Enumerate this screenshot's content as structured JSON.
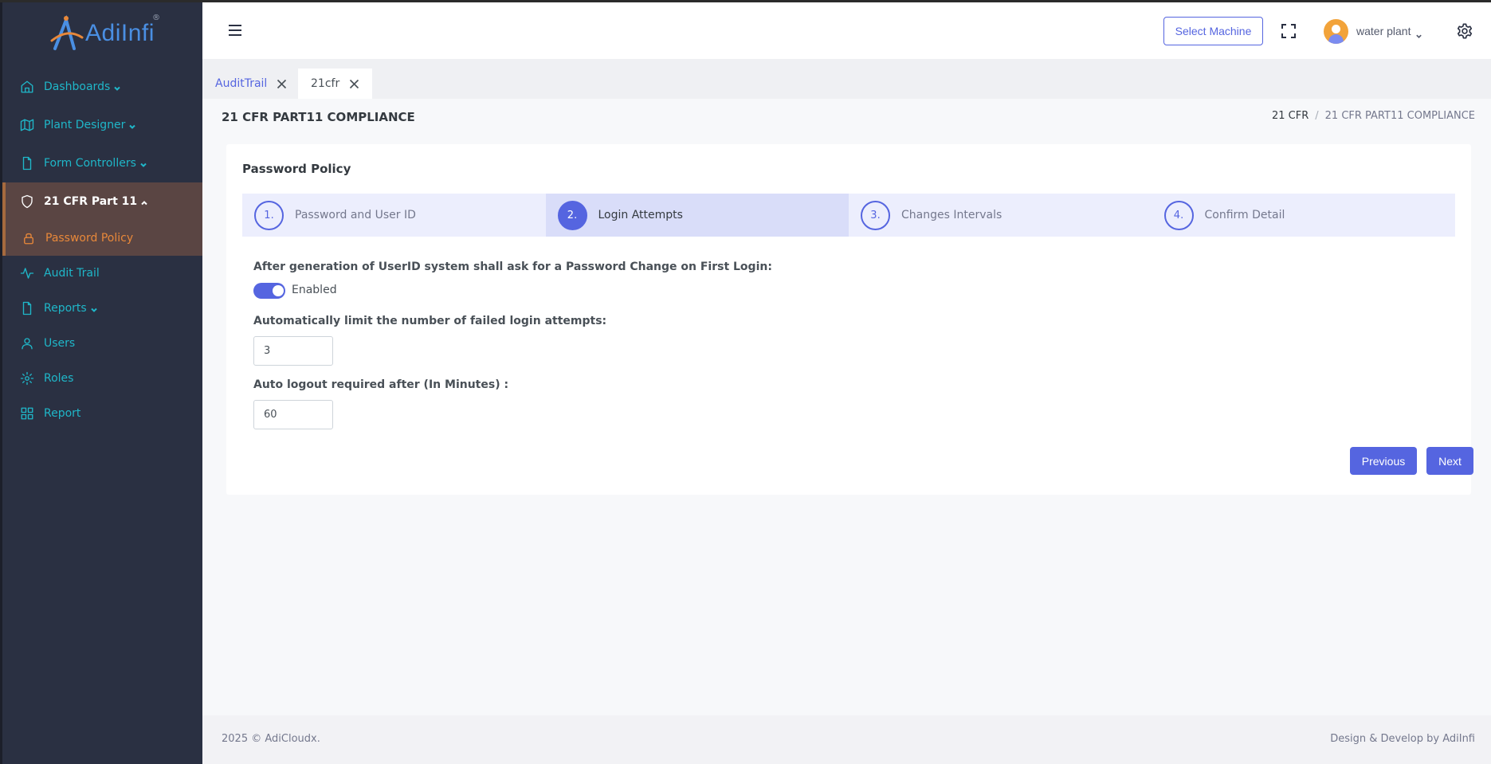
{
  "brand": {
    "logo_text": "AdiInfi",
    "registered": "®"
  },
  "sidebar": {
    "items": [
      {
        "label": "Dashboards",
        "icon": "home-icon"
      },
      {
        "label": "Plant Designer",
        "icon": "map-icon"
      },
      {
        "label": "Form Controllers",
        "icon": "file-icon"
      },
      {
        "label": "21 CFR Part 11",
        "icon": "shield-icon"
      },
      {
        "label": "Password Policy",
        "icon": "lock-icon"
      },
      {
        "label": "Audit Trail",
        "icon": "activity-icon"
      },
      {
        "label": "Reports",
        "icon": "file-icon"
      },
      {
        "label": "Users",
        "icon": "user-icon"
      },
      {
        "label": "Roles",
        "icon": "settings-icon"
      },
      {
        "label": "Report",
        "icon": "grid-icon"
      }
    ]
  },
  "header": {
    "select_machine_label": "Select Machine",
    "user_name": "water plant"
  },
  "tabs": [
    {
      "label": "AuditTrail"
    },
    {
      "label": "21cfr"
    }
  ],
  "page": {
    "title": "21 CFR PART11 COMPLIANCE",
    "breadcrumb": [
      "21 CFR",
      "/",
      "21 CFR PART11 COMPLIANCE"
    ]
  },
  "card": {
    "title": "Password Policy",
    "steps": [
      {
        "num": "1.",
        "label": "Password and User ID"
      },
      {
        "num": "2.",
        "label": "Login Attempts"
      },
      {
        "num": "3.",
        "label": "Changes Intervals"
      },
      {
        "num": "4.",
        "label": "Confirm Detail"
      }
    ],
    "current_step": 2,
    "first_login_label": "After generation of UserID system shall ask for a Password Change on First Login:",
    "first_login_status": "Enabled",
    "failed_attempts_label": "Automatically limit the number of failed login attempts:",
    "failed_attempts_value": "3",
    "auto_logout_label": "Auto logout required after (In Minutes) :",
    "auto_logout_value": "60",
    "previous_label": "Previous",
    "next_label": "Next"
  },
  "footer": {
    "copyright": "2025 © AdiCloudx.",
    "credit": "Design & Develop by AdiInfi"
  },
  "colors": {
    "sidebar_bg": "#2a3042",
    "sidebar_text": "#1fb7c9",
    "active_bg": "#5a4543",
    "active_sub_text": "#e8883a",
    "primary": "#5565e0"
  }
}
